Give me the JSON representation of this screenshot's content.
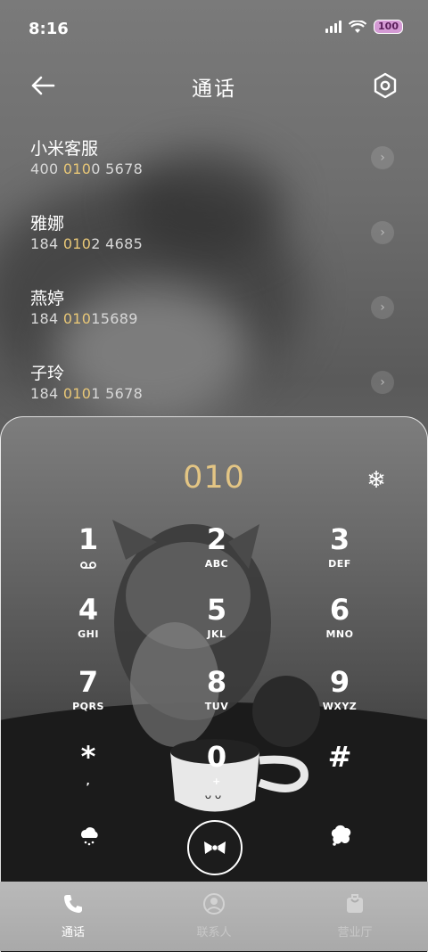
{
  "status": {
    "time": "8:16",
    "battery": "100"
  },
  "header": {
    "title": "通话"
  },
  "contacts": [
    {
      "name": "小米客服",
      "num_pre": "400 ",
      "num_hl": "010",
      "num_post": "0 5678"
    },
    {
      "name": "雅娜",
      "num_pre": "184 ",
      "num_hl": "010",
      "num_post": "2 4685"
    },
    {
      "name": "燕婷",
      "num_pre": "184 ",
      "num_hl": "010",
      "num_post": "15689"
    },
    {
      "name": "子玲",
      "num_pre": "184 ",
      "num_hl": "010",
      "num_post": "1 5678"
    }
  ],
  "dialer": {
    "number": "010",
    "keys": [
      {
        "digit": "1",
        "letters": ""
      },
      {
        "digit": "2",
        "letters": "ABC"
      },
      {
        "digit": "3",
        "letters": "DEF"
      },
      {
        "digit": "4",
        "letters": "GHI"
      },
      {
        "digit": "5",
        "letters": "JKL"
      },
      {
        "digit": "6",
        "letters": "MNO"
      },
      {
        "digit": "7",
        "letters": "PQRS"
      },
      {
        "digit": "8",
        "letters": "TUV"
      },
      {
        "digit": "9",
        "letters": "WXYZ"
      },
      {
        "digit": "*",
        "letters": ","
      },
      {
        "digit": "0",
        "letters": "+"
      },
      {
        "digit": "#",
        "letters": ""
      }
    ]
  },
  "nav": {
    "calls": "通话",
    "contacts": "联系人",
    "store": "营业厅"
  },
  "colors": {
    "accent": "#e3c584",
    "highlight": "#e8c777"
  }
}
